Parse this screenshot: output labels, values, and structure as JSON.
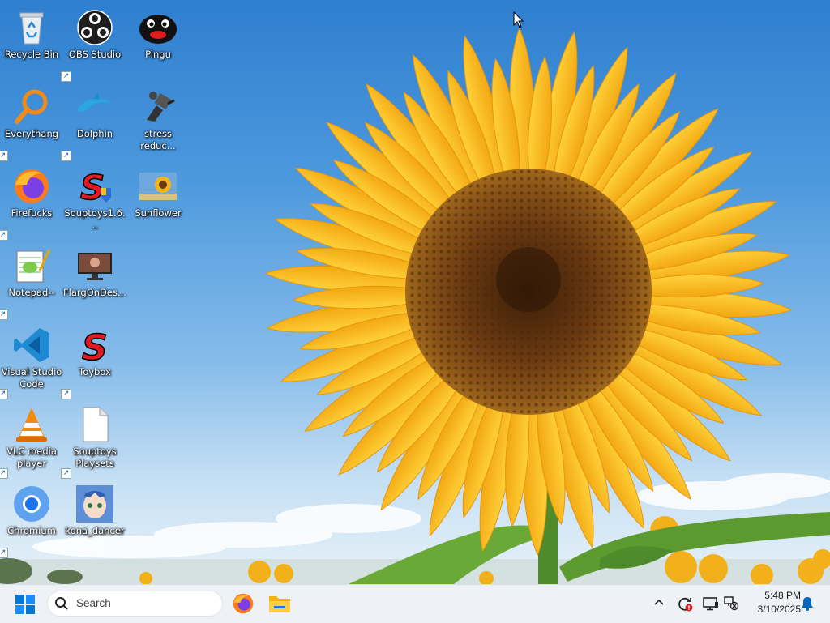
{
  "desktop": {
    "icons": [
      {
        "label": "Recycle Bin",
        "icon": "recycle-bin-icon",
        "shortcut": false
      },
      {
        "label": "OBS Studio",
        "icon": "obs-studio-icon",
        "shortcut": true
      },
      {
        "label": "Pingu",
        "icon": "pingu-icon",
        "shortcut": false
      },
      {
        "label": "Everythang",
        "icon": "everything-search-icon",
        "shortcut": true
      },
      {
        "label": "Dolphin",
        "icon": "dolphin-icon",
        "shortcut": true
      },
      {
        "label": "stress reduc...",
        "icon": "stress-reducer-icon",
        "shortcut": false
      },
      {
        "label": "Firefucks",
        "icon": "firefox-icon",
        "shortcut": true
      },
      {
        "label": "Souptoys1.6...",
        "icon": "souptoys-installer-icon",
        "shortcut": false
      },
      {
        "label": "Sunflower",
        "icon": "sunflower-image-icon",
        "shortcut": false
      },
      {
        "label": "Notepad--",
        "icon": "notepad-icon",
        "shortcut": true
      },
      {
        "label": "FlargOnDes...",
        "icon": "monitor-app-icon",
        "shortcut": false
      },
      {
        "label": "Visual Studio Code",
        "icon": "vscode-icon",
        "shortcut": true
      },
      {
        "label": "Toybox",
        "icon": "souptoys-icon",
        "shortcut": true
      },
      {
        "label": "VLC media player",
        "icon": "vlc-icon",
        "shortcut": true
      },
      {
        "label": "Souptoys Playsets",
        "icon": "blank-file-icon",
        "shortcut": true
      },
      {
        "label": "Chromium",
        "icon": "chromium-icon",
        "shortcut": true
      },
      {
        "label": "kona_dancer",
        "icon": "anime-girl-icon",
        "shortcut": false
      }
    ]
  },
  "taskbar": {
    "start_icon": "windows-start-icon",
    "search_placeholder": "Search",
    "pinned": [
      {
        "name": "Firefox",
        "icon": "firefox-icon"
      },
      {
        "name": "File Explorer",
        "icon": "folder-icon"
      }
    ],
    "tray_icons": [
      "chevron-up-icon",
      "sync-icon",
      "monitor-icon",
      "network-disconnected-icon"
    ],
    "clock": {
      "time": "5:48 PM",
      "date": "3/10/2025"
    },
    "notification_icon": "bell-icon"
  },
  "colors": {
    "sky_top": "#2f7fd0",
    "petal": "#f7b51e",
    "disk": "#6b3a12",
    "taskbar": "#eef2f6",
    "accent": "#0067c0"
  }
}
